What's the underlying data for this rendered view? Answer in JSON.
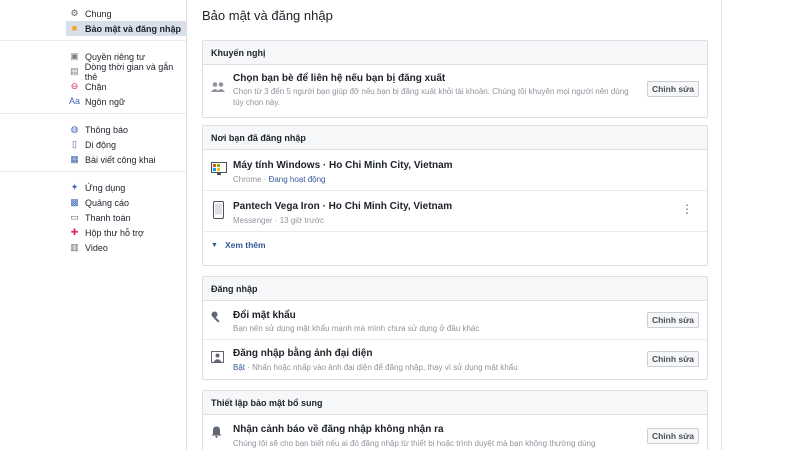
{
  "sidebar": {
    "groups": [
      [
        {
          "label": "Chung",
          "icon": "gear-icon",
          "glyph": "⚙",
          "color": "#606770"
        },
        {
          "label": "Bảo mật và đăng nhập",
          "icon": "shield-icon",
          "glyph": "■",
          "color": "#f5a623",
          "active": true
        }
      ],
      [
        {
          "label": "Quyền riêng tư",
          "icon": "lock-icon",
          "glyph": "▣",
          "color": "#7a7f87"
        },
        {
          "label": "Dòng thời gian và gắn thẻ",
          "icon": "timeline-icon",
          "glyph": "▤",
          "color": "#7a7f87"
        },
        {
          "label": "Chặn",
          "icon": "block-icon",
          "glyph": "⊖",
          "color": "#e0245e"
        },
        {
          "label": "Ngôn ngữ",
          "icon": "language-icon",
          "glyph": "Aa",
          "color": "#4267b2"
        }
      ],
      [
        {
          "label": "Thông báo",
          "icon": "globe-icon",
          "glyph": "◍",
          "color": "#4267b2"
        },
        {
          "label": "Di động",
          "icon": "mobile-icon",
          "glyph": "▯",
          "color": "#4267b2"
        },
        {
          "label": "Bài viết công khai",
          "icon": "rss-icon",
          "glyph": "▦",
          "color": "#4267b2"
        }
      ],
      [
        {
          "label": "Ứng dụng",
          "icon": "apps-icon",
          "glyph": "✦",
          "color": "#4267b2"
        },
        {
          "label": "Quảng cáo",
          "icon": "ads-icon",
          "glyph": "▩",
          "color": "#4267b2"
        },
        {
          "label": "Thanh toán",
          "icon": "payment-icon",
          "glyph": "▭",
          "color": "#606770"
        },
        {
          "label": "Hộp thư hỗ trợ",
          "icon": "support-icon",
          "glyph": "✚",
          "color": "#e0245e"
        },
        {
          "label": "Video",
          "icon": "video-icon",
          "glyph": "▥",
          "color": "#606770"
        }
      ]
    ]
  },
  "main": {
    "title": "Bảo mật và đăng nhập",
    "recommended": {
      "header": "Khuyến nghị",
      "title": "Chọn bạn bè để liên hệ nếu bạn bị đăng xuất",
      "subtitle": "Chọn từ 3 đến 5 người bạn giúp đỡ nếu bạn bị đăng xuất khỏi tài khoản. Chúng tôi khuyên mọi người nên dùng tùy chọn này.",
      "button": "Chỉnh sửa"
    },
    "where_logged_in": {
      "header": "Nơi bạn đã đăng nhập",
      "sessions": [
        {
          "device": "Máy tính Windows · Ho Chi Minh City, Vietnam",
          "app": "Chrome",
          "separator": " · ",
          "status": "Đang hoạt động"
        },
        {
          "device": "Pantech Vega Iron · Ho Chi Minh City, Vietnam",
          "app": "Messenger",
          "separator": " · ",
          "status": "13 giờ trước"
        }
      ],
      "see_more": "Xem thêm"
    },
    "login": {
      "header": "Đăng nhập",
      "change_password": {
        "title": "Đổi mật khẩu",
        "subtitle": "Bạn nên sử dụng mật khẩu mạnh mà mình chưa sử dụng ở đâu khác",
        "button": "Chỉnh sửa"
      },
      "profile_login": {
        "title": "Đăng nhập bằng ảnh đại diện",
        "status": "Bật",
        "subtitle": " · Nhấn hoặc nhấp vào ảnh đại diện để đăng nhập, thay vì sử dụng mật khẩu",
        "button": "Chỉnh sửa"
      }
    },
    "extra_security": {
      "header": "Thiết lập bảo mật bổ sung",
      "alerts": {
        "title": "Nhận cảnh báo về đăng nhập không nhận ra",
        "subtitle": "Chúng tôi sẽ cho bạn biết nếu ai đó đăng nhập từ thiết bị hoặc trình duyệt mà bạn không thường dùng",
        "button": "Chỉnh sửa"
      }
    }
  }
}
